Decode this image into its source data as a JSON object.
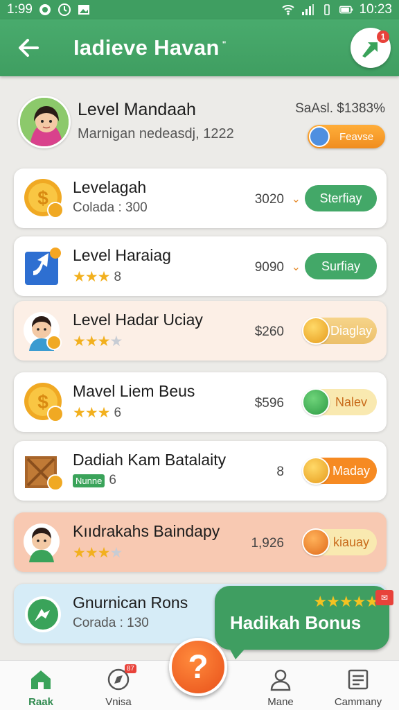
{
  "status_bar": {
    "time": "1:99",
    "right_time": "10:23",
    "icons": [
      "record-icon",
      "clock-icon",
      "image-icon",
      "wifi-icon",
      "signal-icon",
      "vibrate-icon",
      "battery-icon"
    ]
  },
  "app_bar": {
    "title": "Iadieve Havan",
    "title_mark": "\"",
    "share_badge": "1",
    "accent_color": "#3f9e61"
  },
  "profile": {
    "name": "Level Mandaah",
    "subtitle": "Marnigan nedeasdj, 1222",
    "balance": "SaAsl. $1383%",
    "feature_button": "Feavse"
  },
  "cards": [
    {
      "title": "Levelagah",
      "sub_text": "Colada : 300",
      "value": "3020",
      "button": "Sterfiay",
      "icon": "coin-icon",
      "style": "white",
      "button_style": "green"
    },
    {
      "title": "Level Haraiag",
      "rating": 3,
      "rating_max": 3,
      "rating_text": "8",
      "value": "9090",
      "button": "Surfiay",
      "icon": "boost-icon",
      "style": "white",
      "button_style": "green"
    },
    {
      "title": "Level Hadar Uciay",
      "rating": 3,
      "rating_max": 4,
      "value": "$260",
      "button": "Diaglay",
      "icon": "kid-avatar-icon",
      "style": "peach",
      "button_style": "gold"
    },
    {
      "title": "Mavel Liem Beus",
      "rating": 3,
      "rating_max": 3,
      "rating_text": "6",
      "value": "$596",
      "button": "Nalev",
      "icon": "coin-icon",
      "style": "white",
      "button_style": "paleyellow"
    },
    {
      "title": "Dadiah Kam Batalaity",
      "tag": "Nunne",
      "rating_text": "6",
      "value": "8",
      "button": "Maday",
      "icon": "crate-icon",
      "style": "white",
      "button_style": "orange"
    },
    {
      "title": "Kııdrakahs Baindapy",
      "rating": 3,
      "rating_max": 4,
      "value": "1,926",
      "button": "kiauay",
      "icon": "kid-avatar-icon",
      "style": "salmon",
      "button_style": "paleyellow"
    },
    {
      "title": "Gnurnican Rons",
      "sub_text": "Corada : 130",
      "icon": "share-icon",
      "style": "blue"
    }
  ],
  "bonus": {
    "label": "Hadikah Bonus",
    "stars": 5,
    "tag": "✉"
  },
  "bottom_nav": {
    "items": [
      {
        "label": "Raak",
        "icon": "home-icon",
        "active": true
      },
      {
        "label": "Vnisa",
        "icon": "compass-icon",
        "badge": "87"
      },
      {
        "label": "Mane",
        "icon": "person-icon"
      },
      {
        "label": "Cammany",
        "icon": "list-icon"
      }
    ],
    "fab": "?"
  }
}
